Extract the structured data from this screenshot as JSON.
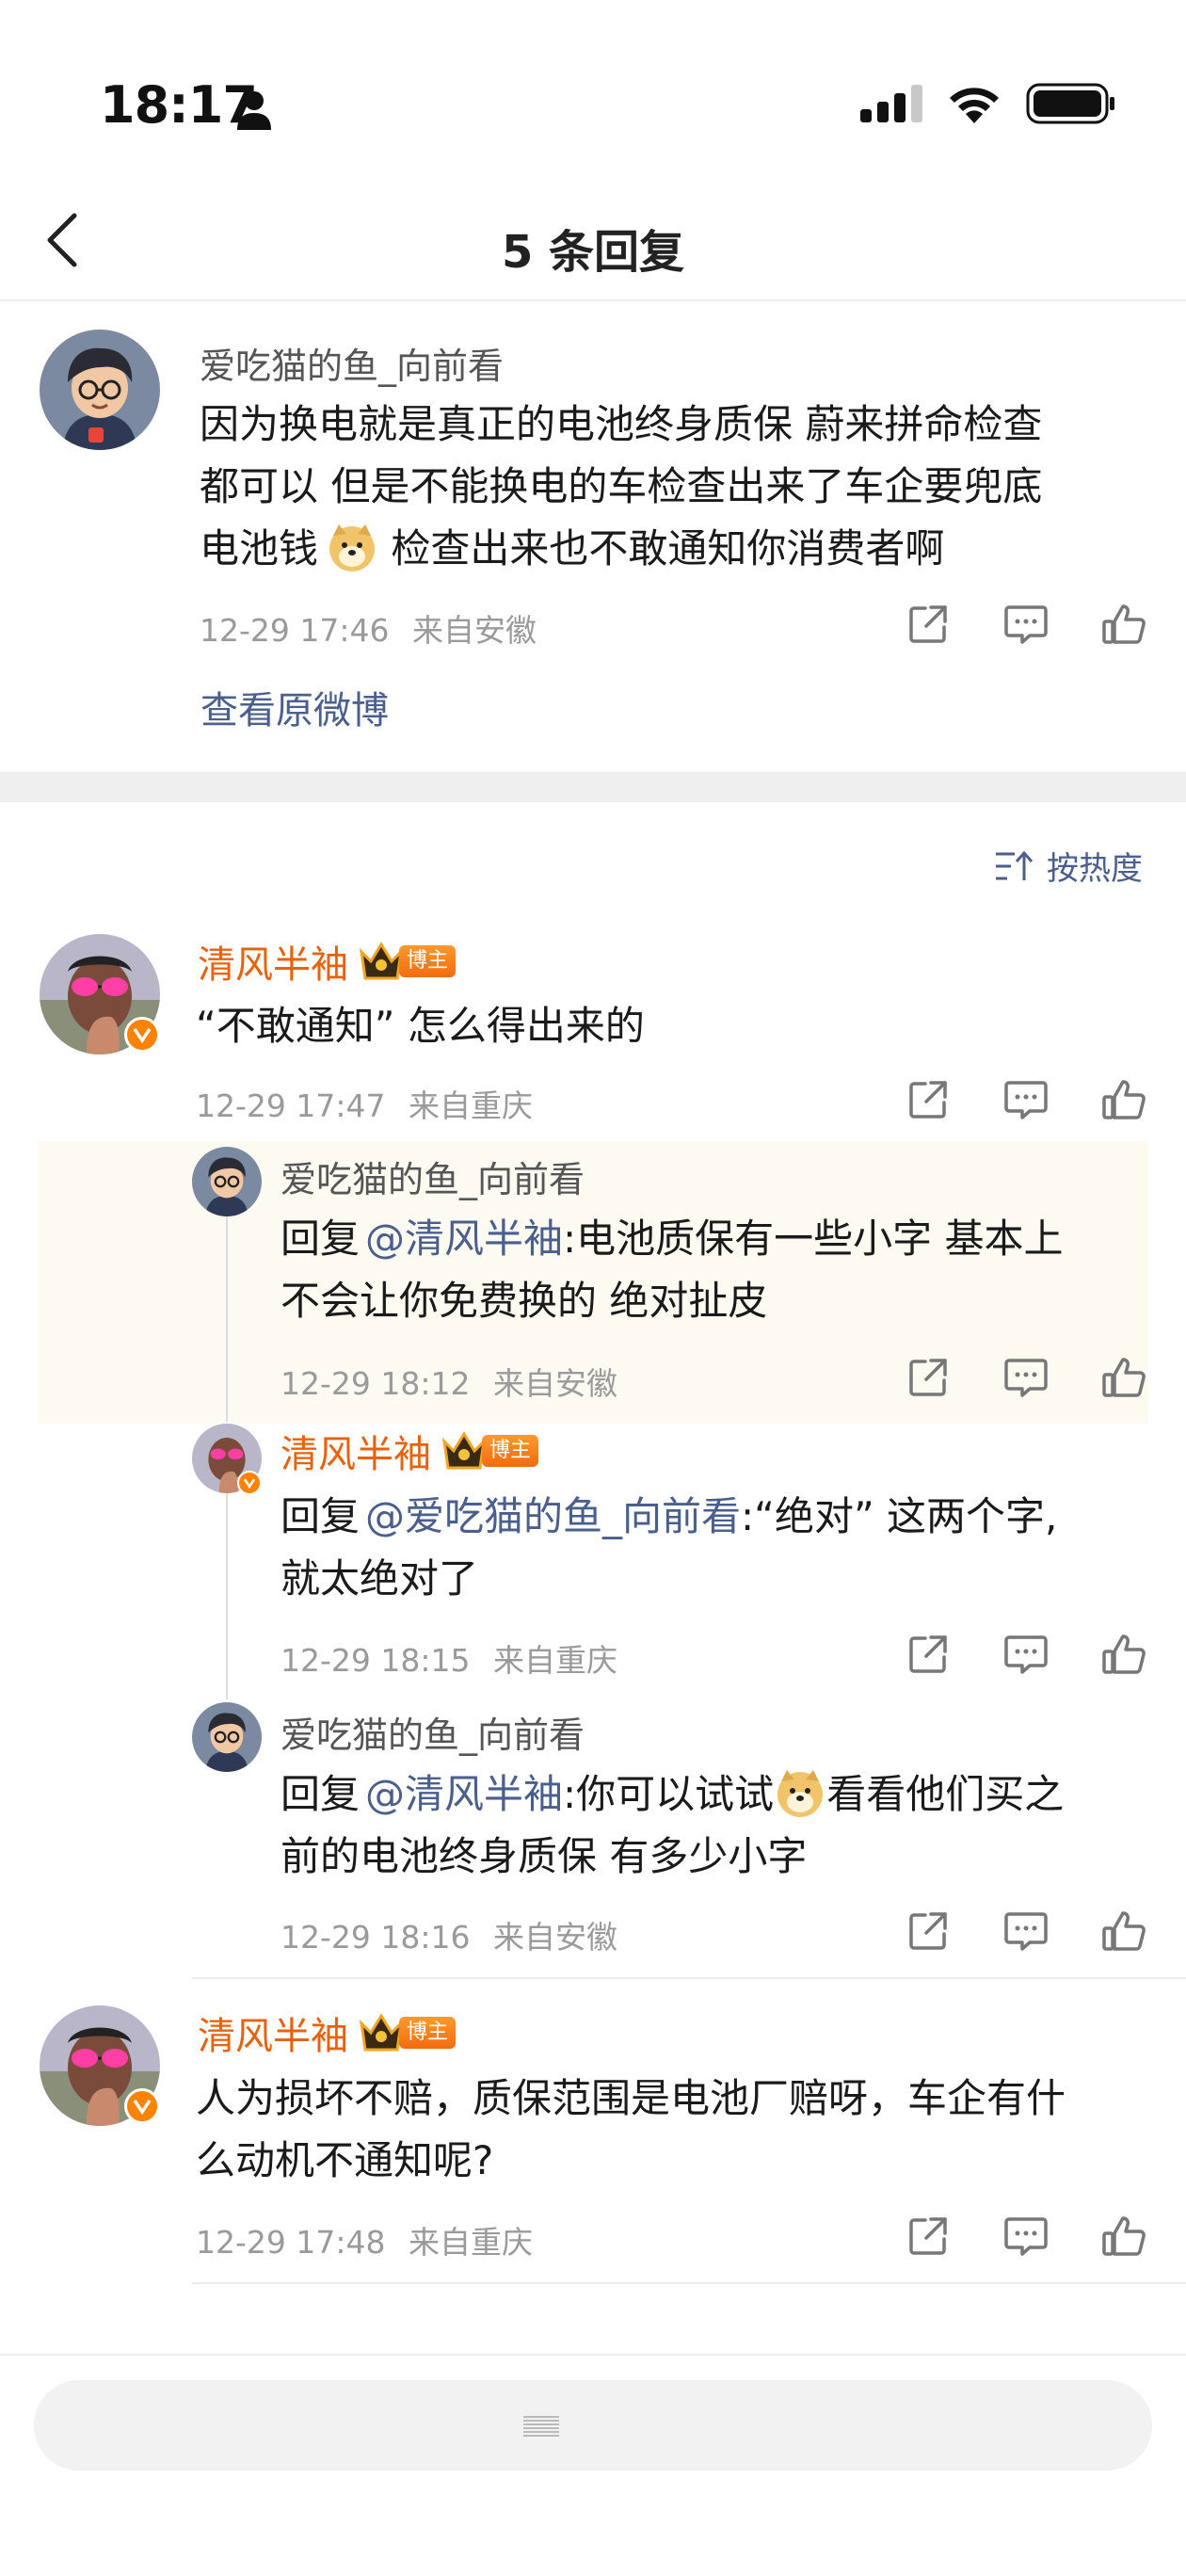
{
  "status_bar": {
    "time": "18:17",
    "icons": [
      "person-icon",
      "signal-icon",
      "wifi-icon",
      "battery-icon"
    ]
  },
  "nav": {
    "title": "5 条回复",
    "back_icon": "chevron-left-icon"
  },
  "root_comment": {
    "author": "爱吃猫的鱼_向前看",
    "lines": [
      "因为换电就是真正的电池终身质保  蔚来拼命检查",
      "都可以   但是不能换电的车检查出来了车企要兜底",
      "电池钱",
      "  检查出来也不敢通知你消费者啊"
    ],
    "time": "12-29 17:46",
    "location": "来自安徽",
    "view_original": "查看原微博"
  },
  "sort_label": "按热度",
  "comments": [
    {
      "author": "清风半袖",
      "badge": "博主",
      "text": "“不敢通知” 怎么得出来的",
      "time": "12-29 17:47",
      "location": "来自重庆"
    },
    {
      "author": "清风半袖",
      "badge": "博主",
      "lines": [
        "人为损坏不赔，质保范围是电池厂赔呀，车企有什",
        "么动机不通知呢?"
      ],
      "time": "12-29 17:48",
      "location": "来自重庆"
    }
  ],
  "replies": [
    {
      "author": "爱吃猫的鱼_向前看",
      "prefix": "回复",
      "mention": "@清风半袖",
      "line1_rest": ":电池质保有一些小字  基本上",
      "line2": "不会让你免费换的  绝对扯皮",
      "time": "12-29 18:12",
      "location": "来自安徽"
    },
    {
      "author": "清风半袖",
      "badge": "博主",
      "prefix": "回复",
      "mention": "@爱吃猫的鱼_向前看",
      "line1_rest": ":“绝对” 这两个字,",
      "line2": "就太绝对了",
      "time": "12-29 18:15",
      "location": "来自重庆"
    },
    {
      "author": "爱吃猫的鱼_向前看",
      "prefix": "回复",
      "mention": "@清风半袖",
      "line1_a": ":你可以试试",
      "line1_b": "看看他们买之",
      "line2": "前的电池终身质保  有多少小字",
      "time": "12-29 18:16",
      "location": "来自安徽"
    }
  ],
  "colors": {
    "accent_orange": "#e8620c",
    "link_blue": "#4a5f8c",
    "meta_gray": "#9a9a9a",
    "highlight_bg": "#fdfbf1"
  }
}
